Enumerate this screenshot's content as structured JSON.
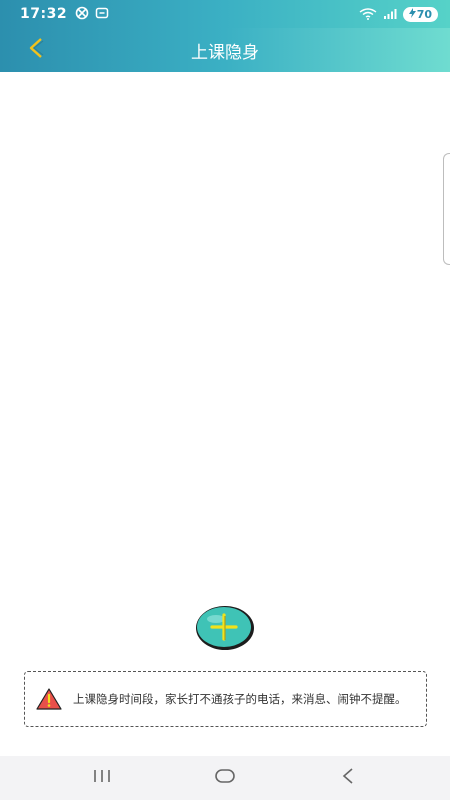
{
  "status_bar": {
    "time": "17:32",
    "battery_level": "70",
    "icons": [
      "alarm-off-icon",
      "screen-capture-icon",
      "wifi-icon",
      "signal-icon",
      "battery-charging-icon"
    ]
  },
  "header": {
    "title": "上课隐身",
    "back_icon": "chevron-left-icon"
  },
  "main": {
    "add_icon": "plus-icon",
    "notice": {
      "icon": "warning-triangle-icon",
      "text": "上课隐身时间段，家长打不通孩子的电话，来消息、闹钟不提醒。"
    }
  },
  "nav_bar": {
    "icons": [
      "recent-apps-icon",
      "home-icon",
      "back-icon"
    ]
  },
  "colors": {
    "header_gradient_start": "#2c8fae",
    "header_gradient_end": "#6fdcd0",
    "back_arrow": "#f2c21b",
    "add_button_fill": "#3fc3b6",
    "add_button_plus": "#f2e21b",
    "warning_fill": "#e8504a"
  }
}
